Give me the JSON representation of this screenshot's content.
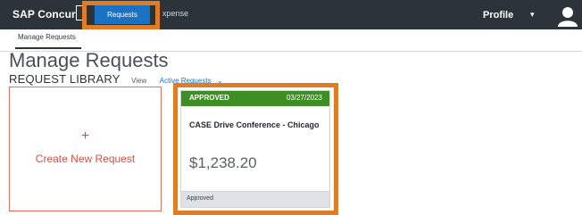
{
  "topbar": {
    "brand": "SAP Concur",
    "brand_fragment": "C",
    "tabs": [
      {
        "label": "Requests",
        "active": true
      },
      {
        "label": "xpense",
        "active": false
      }
    ],
    "profile_label": "Profile",
    "profile_icon": "chevron-down-icon",
    "avatar_icon": "user-avatar-icon"
  },
  "subnav": {
    "item": "Manage Requests"
  },
  "page": {
    "title": "Manage Requests",
    "library_title": "REQUEST LIBRARY",
    "view_label": "View",
    "filter_value": "Active Requests"
  },
  "create_card": {
    "plus": "+",
    "label": "Create New Request"
  },
  "request_card": {
    "status": "APPROVED",
    "date": "03/27/2023",
    "title": "CASE Drive Conference - Chicago",
    "amount": "$1,238.20",
    "footer_status": "Approved"
  },
  "colors": {
    "topbar": "#2d3439",
    "active_tab": "#1a72c4",
    "highlight": "#e07b26",
    "approved": "#3e8e26",
    "create_accent": "#d94f3f"
  }
}
